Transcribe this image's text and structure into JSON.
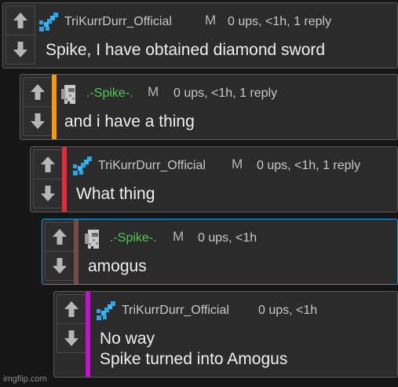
{
  "comments": [
    {
      "username": "TriKurrDurr_Official",
      "badge": "M",
      "stats": "0 ups, <1h, 1 reply",
      "text": "Spike, I have obtained diamond sword",
      "avatar_icon": "diamond-sword-icon",
      "stripe_color": "",
      "username_color": "#c8c8c8"
    },
    {
      "username": ".-Spike-.",
      "badge": "M",
      "stats": "0 ups, <1h, 1 reply",
      "text": "and i have a thing",
      "avatar_icon": "amogus-avatar-icon",
      "stripe_color": "#f39a13",
      "username_color": "#52c856"
    },
    {
      "username": "TriKurrDurr_Official",
      "badge": "M",
      "stats": "0 ups, <1h, 1 reply",
      "text": "What thing",
      "avatar_icon": "diamond-sword-icon",
      "stripe_color": "#e8293c",
      "username_color": "#c8c8c8"
    },
    {
      "username": ".-Spike-.",
      "badge": "M",
      "stats": "0 ups, <1h",
      "text": "amogus",
      "avatar_icon": "amogus-avatar-icon",
      "stripe_color": "#7a4a44",
      "username_color": "#52c856"
    },
    {
      "username": "TriKurrDurr_Official",
      "badge": "",
      "stats": "0 ups, <1h",
      "text": "No way\nSpike turned into Amogus",
      "avatar_icon": "diamond-sword-icon",
      "stripe_color": "#c70ed2",
      "username_color": "#c8c8c8"
    }
  ],
  "watermark": "imgflip.com",
  "colors": {
    "background": "#161616",
    "panel": "#2b2b2b",
    "border": "#5a5a5a",
    "highlight_border": "#1b9ad6"
  }
}
